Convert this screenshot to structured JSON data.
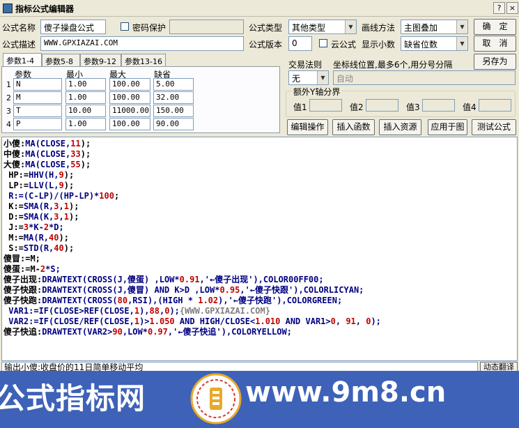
{
  "window": {
    "title": "指标公式编辑器",
    "help_btn": "?",
    "close_btn": "×"
  },
  "form": {
    "name_label": "公式名称",
    "name_value": "傻子操盘公式",
    "password_label": "密码保护",
    "desc_label": "公式描述",
    "desc_value": "WWW.GPXIAZAI.COM",
    "type_label": "公式类型",
    "type_value": "其他类型",
    "draw_label": "画线方法",
    "draw_value": "主图叠加",
    "version_label": "公式版本",
    "version_value": "0",
    "cloud_label": "云公式",
    "decimals_label": "显示小数",
    "decimals_value": "缺省位数",
    "trade_label": "交易法则",
    "trade_value": "无",
    "coord_label": "坐标线位置,最多6个,用分号分隔",
    "coord_value": "自动",
    "extra_axis_label": "额外Y轴分界",
    "axis_labels": [
      "值1",
      "值2",
      "值3",
      "值4"
    ]
  },
  "buttons": {
    "ok": "确　定",
    "cancel": "取　消",
    "save_as": "另存为",
    "edit_op": "编辑操作",
    "insert_func": "插入函数",
    "insert_res": "插入资源",
    "apply_chart": "应用于图",
    "test": "测试公式"
  },
  "tabs": [
    "参数1-4",
    "参数5-8",
    "参数9-12",
    "参数13-16"
  ],
  "params": {
    "headers": [
      "参数",
      "最小",
      "最大",
      "缺省"
    ],
    "rows": [
      {
        "idx": "1",
        "name": "N",
        "min": "1.00",
        "max": "100.00",
        "def": "5.00"
      },
      {
        "idx": "2",
        "name": "M",
        "min": "1.00",
        "max": "100.00",
        "def": "32.00"
      },
      {
        "idx": "3",
        "name": "T",
        "min": "10.00",
        "max": "11000.00",
        "def": "150.00"
      },
      {
        "idx": "4",
        "name": "P",
        "min": "1.00",
        "max": "100.00",
        "def": "90.00"
      }
    ]
  },
  "code_lines": [
    [
      [
        "小傻:",
        "#000"
      ],
      [
        "MA",
        "#000080"
      ],
      [
        "(CLOSE,",
        "#000080"
      ],
      [
        "11",
        "#c00000"
      ],
      [
        ");",
        "#000"
      ]
    ],
    [
      [
        "中傻:",
        "#000"
      ],
      [
        "MA",
        "#000080"
      ],
      [
        "(CLOSE,",
        "#000080"
      ],
      [
        "33",
        "#c00000"
      ],
      [
        ");",
        "#000"
      ]
    ],
    [
      [
        "大傻:",
        "#000"
      ],
      [
        "MA",
        "#000080"
      ],
      [
        "(CLOSE,",
        "#000080"
      ],
      [
        "55",
        "#c00000"
      ],
      [
        ");",
        "#000"
      ]
    ],
    [
      [
        " HP:=",
        "#000"
      ],
      [
        "HHV",
        "#000080"
      ],
      [
        "(H,",
        "#000080"
      ],
      [
        "9",
        "#c00000"
      ],
      [
        ");",
        "#000"
      ]
    ],
    [
      [
        " LP:=",
        "#000"
      ],
      [
        "LLV",
        "#000080"
      ],
      [
        "(L,",
        "#000080"
      ],
      [
        "9",
        "#c00000"
      ],
      [
        ");",
        "#000"
      ]
    ],
    [
      [
        " R:=(C-LP)/(HP-LP)*",
        "#000080"
      ],
      [
        "100",
        "#c00000"
      ],
      [
        ";",
        "#000"
      ]
    ],
    [
      [
        " K:=",
        "#000"
      ],
      [
        "SMA",
        "#000080"
      ],
      [
        "(R,",
        "#000080"
      ],
      [
        "3",
        "#c00000"
      ],
      [
        ",",
        "#000080"
      ],
      [
        "1",
        "#c00000"
      ],
      [
        ");",
        "#000"
      ]
    ],
    [
      [
        " D:=",
        "#000"
      ],
      [
        "SMA",
        "#000080"
      ],
      [
        "(K,",
        "#000080"
      ],
      [
        "3",
        "#c00000"
      ],
      [
        ",",
        "#000080"
      ],
      [
        "1",
        "#c00000"
      ],
      [
        ");",
        "#000"
      ]
    ],
    [
      [
        " J:=",
        "#000"
      ],
      [
        "3",
        "#c00000"
      ],
      [
        "*K-",
        "#000080"
      ],
      [
        "2",
        "#c00000"
      ],
      [
        "*D;",
        "#000080"
      ]
    ],
    [
      [
        " M:=",
        "#000"
      ],
      [
        "MA",
        "#000080"
      ],
      [
        "(R,",
        "#000080"
      ],
      [
        "40",
        "#c00000"
      ],
      [
        ");",
        "#000"
      ]
    ],
    [
      [
        " S:=",
        "#000"
      ],
      [
        "STD",
        "#000080"
      ],
      [
        "(R,",
        "#000080"
      ],
      [
        "40",
        "#c00000"
      ],
      [
        ");",
        "#000"
      ]
    ],
    [
      [
        "傻冒:=M;",
        "#000"
      ]
    ],
    [
      [
        "傻蛋:=M-",
        "#000"
      ],
      [
        "2",
        "#c00000"
      ],
      [
        "*S;",
        "#000080"
      ]
    ],
    [
      [
        "傻子出现:",
        "#000"
      ],
      [
        "DRAWTEXT(CROSS(J,傻蛋) ,LOW*",
        "#000080"
      ],
      [
        "0.91",
        "#c00000"
      ],
      [
        ",'←傻子出现'),COLOR00FF00;",
        "#000080"
      ]
    ],
    [
      [
        "傻子快跟:",
        "#000"
      ],
      [
        "DRAWTEXT(CROSS(J,傻冒) AND K>D ,LOW*",
        "#000080"
      ],
      [
        "0.95",
        "#c00000"
      ],
      [
        ",'←傻子快跟'),COLORLICYAN;",
        "#000080"
      ]
    ],
    [
      [
        "傻子快跑:",
        "#000"
      ],
      [
        "DRAWTEXT(CROSS(",
        "#000080"
      ],
      [
        "80",
        "#c00000"
      ],
      [
        ",RSI),(HIGH * ",
        "#000080"
      ],
      [
        "1.02",
        "#c00000"
      ],
      [
        "),'←傻子快跑'),COLORGREEN;",
        "#000080"
      ]
    ],
    [
      [
        " VAR1:=IF(CLOSE>REF(CLOSE,",
        "#000080"
      ],
      [
        "1",
        "#c00000"
      ],
      [
        "),",
        "#000080"
      ],
      [
        "88",
        "#c00000"
      ],
      [
        ",",
        "#000080"
      ],
      [
        "0",
        "#c00000"
      ],
      [
        ");",
        "#000080"
      ],
      [
        "{WWW.GPXIAZAI.COM}",
        "#808080"
      ]
    ],
    [
      [
        " VAR2:=IF(CLOSE/REF(CLOSE,",
        "#000080"
      ],
      [
        "1",
        "#c00000"
      ],
      [
        ")>",
        "#000080"
      ],
      [
        "1.050",
        "#c00000"
      ],
      [
        " AND HIGH/CLOSE<",
        "#000080"
      ],
      [
        "1.010",
        "#c00000"
      ],
      [
        " AND VAR1>",
        "#000080"
      ],
      [
        "0",
        "#c00000"
      ],
      [
        ", ",
        "#000080"
      ],
      [
        "91",
        "#c00000"
      ],
      [
        ", ",
        "#000080"
      ],
      [
        "0",
        "#c00000"
      ],
      [
        ");",
        "#000080"
      ]
    ],
    [
      [
        "傻子快追:",
        "#000"
      ],
      [
        "DRAWTEXT(VAR2>",
        "#000080"
      ],
      [
        "90",
        "#c00000"
      ],
      [
        ",LOW*",
        "#000080"
      ],
      [
        "0.97",
        "#c00000"
      ],
      [
        ",'←傻子快追'),COLORYELLOW;",
        "#000080"
      ]
    ]
  ],
  "status": {
    "text": "输出小傻:收盘价的11日简单移动平均",
    "dynamic_btn": "动态翻译"
  },
  "banner": {
    "left_text": "公式指标网",
    "right_text": "www.9m8.cn",
    "logo_text": "9m8.cn"
  }
}
